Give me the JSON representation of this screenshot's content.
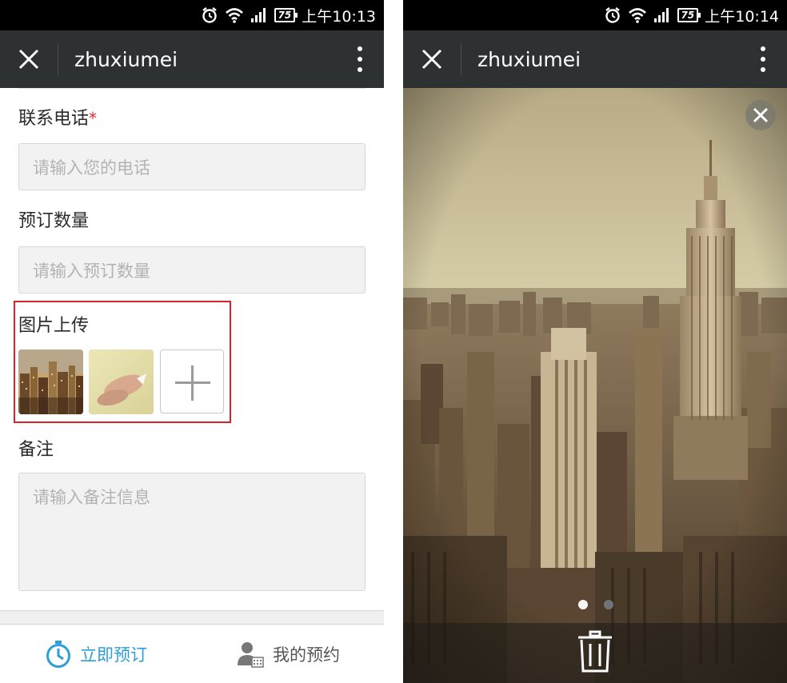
{
  "left": {
    "status": {
      "time": "上午10:13",
      "battery": "75"
    },
    "titlebar": {
      "title": "zhuxiumei"
    },
    "form": {
      "phone": {
        "label": "联系电话",
        "required_mark": "*",
        "placeholder": "请输入您的电话"
      },
      "quantity": {
        "label": "预订数量",
        "placeholder": "请输入预订数量"
      },
      "upload": {
        "label": "图片上传"
      },
      "remark": {
        "label": "备注",
        "placeholder": "请输入备注信息"
      }
    },
    "tabs": [
      {
        "label": "立即预订",
        "icon": "clock-icon",
        "active": true
      },
      {
        "label": "我的预约",
        "icon": "user-calendar-icon",
        "active": false
      }
    ]
  },
  "right": {
    "status": {
      "time": "上午10:14",
      "battery": "75"
    },
    "titlebar": {
      "title": "zhuxiumei"
    },
    "viewer": {
      "page_count": 2,
      "current_page": 1
    }
  },
  "colors": {
    "accent": "#2e9ed6",
    "titlebar": "#2e3132",
    "highlight": "#d8232a",
    "required": "#e02a2a"
  }
}
